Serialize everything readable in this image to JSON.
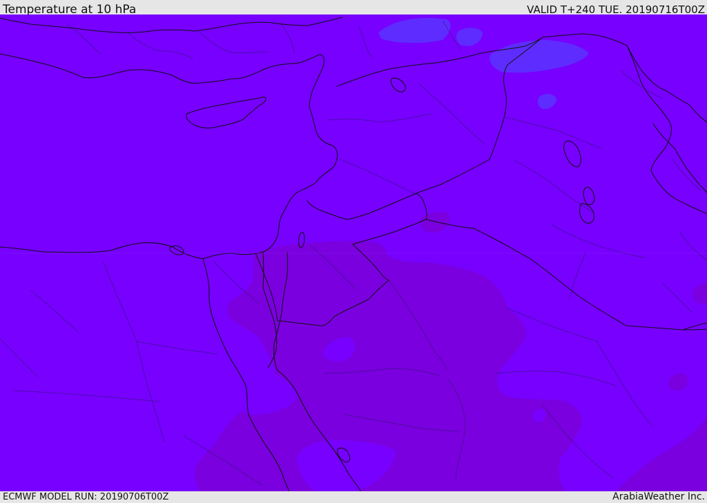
{
  "header": {
    "title": "Temperature at 10 hPa",
    "valid_time": "VALID T+240 TUE. 20190716T00Z"
  },
  "footer": {
    "model_run": "ECMWF MODEL RUN: 20190706T00Z",
    "brand": "ArabiaWeather Inc."
  },
  "map": {
    "background_color": "#7700ff",
    "warm_region_color": "#7a00df",
    "cool_region_color": "#5e2cff",
    "coast_color": "#111111",
    "border_color": "#111111",
    "subdivision_color": "#2b1a66"
  }
}
